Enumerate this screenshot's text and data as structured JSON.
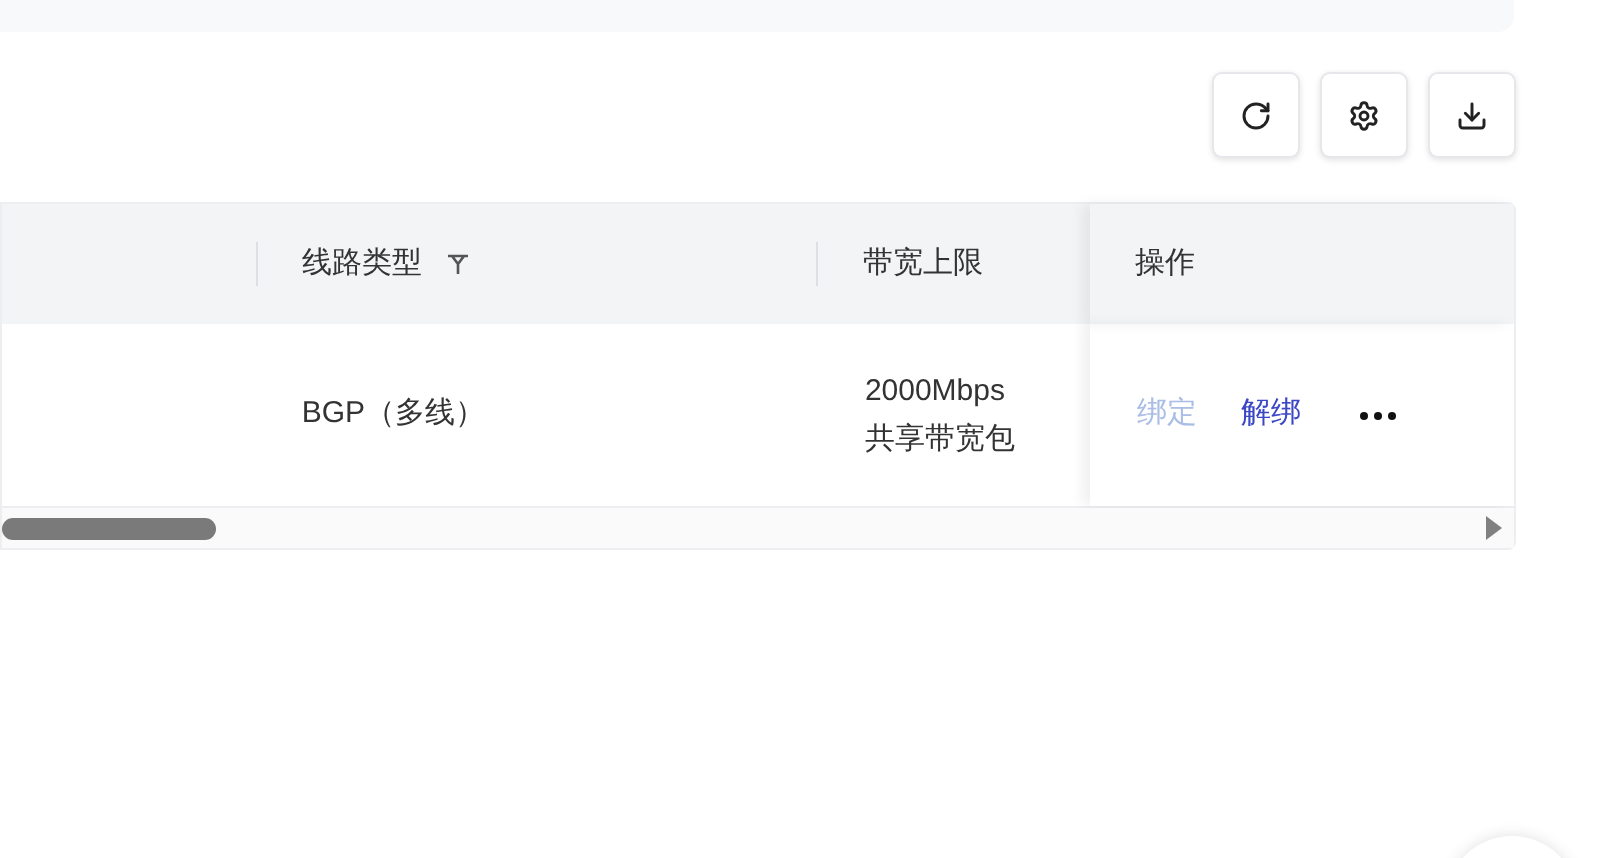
{
  "toolbar": [
    {
      "kind": "refresh"
    },
    {
      "kind": "settings"
    },
    {
      "kind": "download"
    }
  ],
  "table": {
    "columns": [
      {
        "label": "线路类型",
        "filterable": true
      },
      {
        "label": "带宽上限"
      },
      {
        "label": "操作"
      }
    ],
    "rows": [
      {
        "line_type": "BGP（多线）",
        "bandwidth": [
          "2000Mbps",
          "共享带宽包"
        ],
        "actions": [
          {
            "label": "绑定",
            "disabled": true
          },
          {
            "label": "解绑",
            "disabled": false
          }
        ]
      }
    ]
  }
}
